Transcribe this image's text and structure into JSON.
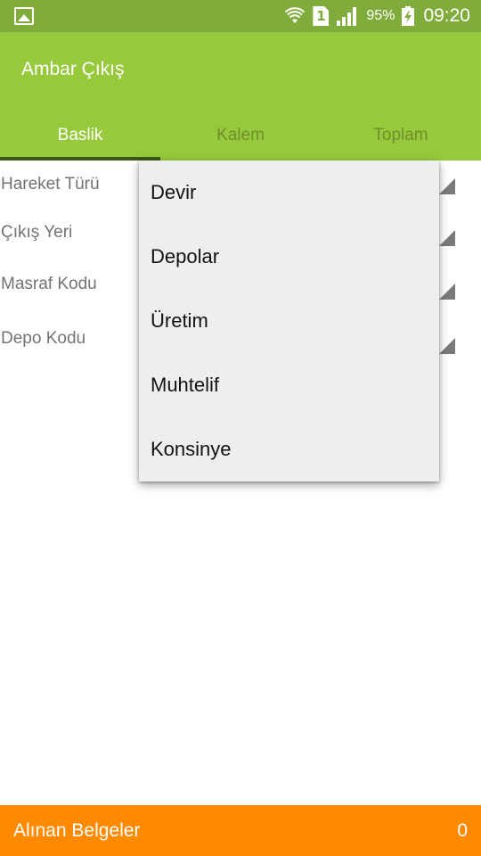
{
  "status_bar": {
    "battery": "95%",
    "time": "09:20",
    "sim_slot": "1",
    "icons": [
      "gallery-icon",
      "wifi-icon",
      "sim-icon",
      "signal-icon",
      "battery-charging-icon"
    ]
  },
  "app_bar": {
    "title": "Ambar Çıkış",
    "tabs": [
      {
        "label": "Baslik",
        "active": true
      },
      {
        "label": "Kalem",
        "active": false
      },
      {
        "label": "Toplam",
        "active": false
      }
    ]
  },
  "form": {
    "fields": [
      {
        "label": "Hareket Türü"
      },
      {
        "label": "Çıkış Yeri"
      },
      {
        "label": "Masraf Kodu"
      },
      {
        "label": "Depo Kodu"
      }
    ]
  },
  "dropdown": {
    "options": [
      "Devir",
      "Depolar",
      "Üretim",
      "Muhtelif",
      "Konsinye"
    ]
  },
  "bottom_bar": {
    "label": "Alınan Belgeler",
    "count": "0"
  },
  "colors": {
    "status_bar": "#80ac3b",
    "app_bar": "#97c93d",
    "tab_indicator": "#3b5a14",
    "bottom_bar": "#ff8a00",
    "dropdown_bg": "#eeeeee"
  }
}
